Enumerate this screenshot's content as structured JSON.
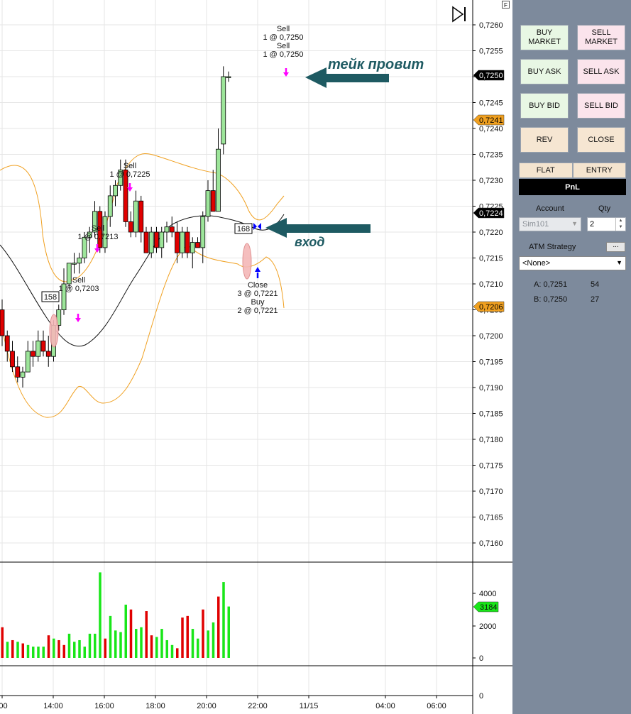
{
  "price_axis": {
    "labels": [
      "0,7260",
      "0,7255",
      "0,7250",
      "0,7245",
      "0,7240",
      "0,7235",
      "0,7230",
      "0,7225",
      "0,7220",
      "0,7215",
      "0,7210",
      "0,7205",
      "0,7200",
      "0,7195",
      "0,7190",
      "0,7185",
      "0,7180",
      "0,7175",
      "0,7170",
      "0,7165",
      "0,7160"
    ],
    "markers": [
      {
        "text": "0,7250",
        "bg": "#000000",
        "color": "#ffffff"
      },
      {
        "text": "0,7241",
        "bg": "#f0a020",
        "color": "#000000"
      },
      {
        "text": "0,7224",
        "bg": "#000000",
        "color": "#ffffff"
      },
      {
        "text": "0,7206",
        "bg": "#f0a020",
        "color": "#000000"
      }
    ]
  },
  "volume_axis": {
    "labels": [
      "4000",
      "2000",
      "0"
    ],
    "last": "3184",
    "lower_zero": "0"
  },
  "time_axis": {
    "labels": [
      ":00",
      "14:00",
      "16:00",
      "18:00",
      "20:00",
      "22:00",
      "11/15",
      "04:00",
      "06:00"
    ]
  },
  "executions": {
    "sell_1": {
      "line1": "Sell",
      "line2": "1 @ 0,7203"
    },
    "sell_2": {
      "line1": "Sell",
      "line2": "1 @ 0,7213"
    },
    "sell_3": {
      "line1": "Sell",
      "line2": "1 @ 0,7225"
    },
    "sell_4": {
      "line1": "Sell",
      "line2": "1 @ 0,7250"
    },
    "sell_5": {
      "line1": "Sell",
      "line2": "1 @ 0,7250"
    },
    "close": {
      "line1": "Close",
      "line2": "3 @ 0,7221",
      "line3": "Buy",
      "line4": "2 @ 0,7221"
    }
  },
  "bar_counters": {
    "left": "158",
    "right": "168"
  },
  "annotations": {
    "take_profit": "тейк провит",
    "entry": "вход"
  },
  "flag_label": "F",
  "panel": {
    "buy_market": "BUY\nMARKET",
    "sell_market": "SELL\nMARKET",
    "buy_ask": "BUY ASK",
    "sell_ask": "SELL ASK",
    "buy_bid": "BUY BID",
    "sell_bid": "SELL BID",
    "rev": "REV",
    "close": "CLOSE",
    "flat": "FLAT",
    "entry": "ENTRY",
    "pnl": "PnL",
    "account_label": "Account",
    "qty_label": "Qty",
    "account": "Sim101",
    "qty": "2",
    "atm_label": "ATM Strategy",
    "atm_dots": "...",
    "atm_value": "<None>",
    "ask": {
      "label": "A: 0,7251",
      "size": "54"
    },
    "bid": {
      "label": "B: 0,7250",
      "size": "27"
    }
  },
  "colors": {
    "up": "#9de59a",
    "down": "#e00000",
    "bollinger": "#f0a020",
    "sma": "#111111",
    "vol_up": "#19e619",
    "vol_down": "#e00000",
    "sell_arrow": "#ff00ff",
    "buy_arrow": "#0000ff",
    "annotation": "#1e5a62"
  },
  "chart_data": {
    "type": "candlestick",
    "y_range": [
      0.7155,
      0.7262
    ],
    "candles": [
      {
        "o": 0.7205,
        "h": 0.7207,
        "l": 0.7198,
        "c": 0.72
      },
      {
        "o": 0.72,
        "h": 0.7201,
        "l": 0.7195,
        "c": 0.7197
      },
      {
        "o": 0.7197,
        "h": 0.7199,
        "l": 0.7193,
        "c": 0.7194
      },
      {
        "o": 0.7194,
        "h": 0.7196,
        "l": 0.7191,
        "c": 0.7192
      },
      {
        "o": 0.7192,
        "h": 0.7194,
        "l": 0.719,
        "c": 0.7193
      },
      {
        "o": 0.7193,
        "h": 0.7199,
        "l": 0.7193,
        "c": 0.7197
      },
      {
        "o": 0.7197,
        "h": 0.7199,
        "l": 0.7194,
        "c": 0.7196
      },
      {
        "o": 0.7196,
        "h": 0.7201,
        "l": 0.7195,
        "c": 0.7199
      },
      {
        "o": 0.7199,
        "h": 0.7201,
        "l": 0.7196,
        "c": 0.7197
      },
      {
        "o": 0.7197,
        "h": 0.72,
        "l": 0.7194,
        "c": 0.7196
      },
      {
        "o": 0.7196,
        "h": 0.7203,
        "l": 0.7195,
        "c": 0.7202
      },
      {
        "o": 0.7202,
        "h": 0.7206,
        "l": 0.7201,
        "c": 0.7205
      },
      {
        "o": 0.7205,
        "h": 0.7213,
        "l": 0.7204,
        "c": 0.721
      },
      {
        "o": 0.721,
        "h": 0.7214,
        "l": 0.7209,
        "c": 0.7214
      },
      {
        "o": 0.7214,
        "h": 0.7216,
        "l": 0.7212,
        "c": 0.7214
      },
      {
        "o": 0.7214,
        "h": 0.7216,
        "l": 0.7212,
        "c": 0.7215
      },
      {
        "o": 0.7215,
        "h": 0.722,
        "l": 0.7214,
        "c": 0.7219
      },
      {
        "o": 0.7219,
        "h": 0.7221,
        "l": 0.7216,
        "c": 0.722
      },
      {
        "o": 0.722,
        "h": 0.7226,
        "l": 0.7219,
        "c": 0.7224
      },
      {
        "o": 0.7224,
        "h": 0.7225,
        "l": 0.7216,
        "c": 0.7217
      },
      {
        "o": 0.7217,
        "h": 0.7224,
        "l": 0.7216,
        "c": 0.7223
      },
      {
        "o": 0.7223,
        "h": 0.7229,
        "l": 0.7221,
        "c": 0.7227
      },
      {
        "o": 0.7227,
        "h": 0.723,
        "l": 0.7225,
        "c": 0.7229
      },
      {
        "o": 0.7229,
        "h": 0.7234,
        "l": 0.7228,
        "c": 0.7232
      },
      {
        "o": 0.7232,
        "h": 0.7234,
        "l": 0.7221,
        "c": 0.7222
      },
      {
        "o": 0.7222,
        "h": 0.7224,
        "l": 0.7219,
        "c": 0.722
      },
      {
        "o": 0.722,
        "h": 0.7228,
        "l": 0.7219,
        "c": 0.7226
      },
      {
        "o": 0.7226,
        "h": 0.7227,
        "l": 0.7218,
        "c": 0.722
      },
      {
        "o": 0.722,
        "h": 0.7221,
        "l": 0.7216,
        "c": 0.7216
      },
      {
        "o": 0.7216,
        "h": 0.7221,
        "l": 0.7215,
        "c": 0.722
      },
      {
        "o": 0.722,
        "h": 0.7221,
        "l": 0.7216,
        "c": 0.7217
      },
      {
        "o": 0.7217,
        "h": 0.7221,
        "l": 0.7215,
        "c": 0.722
      },
      {
        "o": 0.722,
        "h": 0.7222,
        "l": 0.7218,
        "c": 0.7221
      },
      {
        "o": 0.7221,
        "h": 0.7223,
        "l": 0.7219,
        "c": 0.722
      },
      {
        "o": 0.722,
        "h": 0.7222,
        "l": 0.7214,
        "c": 0.7216
      },
      {
        "o": 0.7216,
        "h": 0.7221,
        "l": 0.7215,
        "c": 0.722
      },
      {
        "o": 0.722,
        "h": 0.7221,
        "l": 0.7215,
        "c": 0.7216
      },
      {
        "o": 0.7216,
        "h": 0.7219,
        "l": 0.7213,
        "c": 0.7218
      },
      {
        "o": 0.7218,
        "h": 0.7219,
        "l": 0.7217,
        "c": 0.7217
      },
      {
        "o": 0.7217,
        "h": 0.7224,
        "l": 0.7214,
        "c": 0.7223
      },
      {
        "o": 0.7223,
        "h": 0.723,
        "l": 0.7222,
        "c": 0.7228
      },
      {
        "o": 0.7228,
        "h": 0.7232,
        "l": 0.7224,
        "c": 0.7224
      },
      {
        "o": 0.7224,
        "h": 0.724,
        "l": 0.7224,
        "c": 0.7236
      },
      {
        "o": 0.7237,
        "h": 0.7252,
        "l": 0.7235,
        "c": 0.725
      },
      {
        "o": 0.725,
        "h": 0.7251,
        "l": 0.7249,
        "c": 0.725
      }
    ],
    "volume": [
      {
        "v": 1900,
        "d": true
      },
      {
        "v": 1000,
        "d": false
      },
      {
        "v": 1100,
        "d": true
      },
      {
        "v": 1000,
        "d": false
      },
      {
        "v": 900,
        "d": true
      },
      {
        "v": 800,
        "d": false
      },
      {
        "v": 700,
        "d": false
      },
      {
        "v": 700,
        "d": false
      },
      {
        "v": 700,
        "d": false
      },
      {
        "v": 1400,
        "d": true
      },
      {
        "v": 1200,
        "d": false
      },
      {
        "v": 1100,
        "d": true
      },
      {
        "v": 800,
        "d": true
      },
      {
        "v": 1500,
        "d": false
      },
      {
        "v": 1000,
        "d": false
      },
      {
        "v": 1100,
        "d": false
      },
      {
        "v": 700,
        "d": false
      },
      {
        "v": 1500,
        "d": false
      },
      {
        "v": 1500,
        "d": false
      },
      {
        "v": 5300,
        "d": false
      },
      {
        "v": 1200,
        "d": true
      },
      {
        "v": 2600,
        "d": false
      },
      {
        "v": 1700,
        "d": false
      },
      {
        "v": 1600,
        "d": false
      },
      {
        "v": 3300,
        "d": false
      },
      {
        "v": 3000,
        "d": true
      },
      {
        "v": 1800,
        "d": false
      },
      {
        "v": 1900,
        "d": false
      },
      {
        "v": 2900,
        "d": true
      },
      {
        "v": 1400,
        "d": true
      },
      {
        "v": 1300,
        "d": false
      },
      {
        "v": 1800,
        "d": false
      },
      {
        "v": 1100,
        "d": false
      },
      {
        "v": 800,
        "d": false
      },
      {
        "v": 600,
        "d": true
      },
      {
        "v": 2500,
        "d": true
      },
      {
        "v": 2600,
        "d": true
      },
      {
        "v": 1800,
        "d": false
      },
      {
        "v": 1200,
        "d": false
      },
      {
        "v": 3000,
        "d": true
      },
      {
        "v": 1700,
        "d": false
      },
      {
        "v": 2200,
        "d": false
      },
      {
        "v": 3800,
        "d": true
      },
      {
        "v": 4700,
        "d": false
      },
      {
        "v": 3184,
        "d": false
      }
    ],
    "volume_range": [
      0,
      5800
    ]
  }
}
